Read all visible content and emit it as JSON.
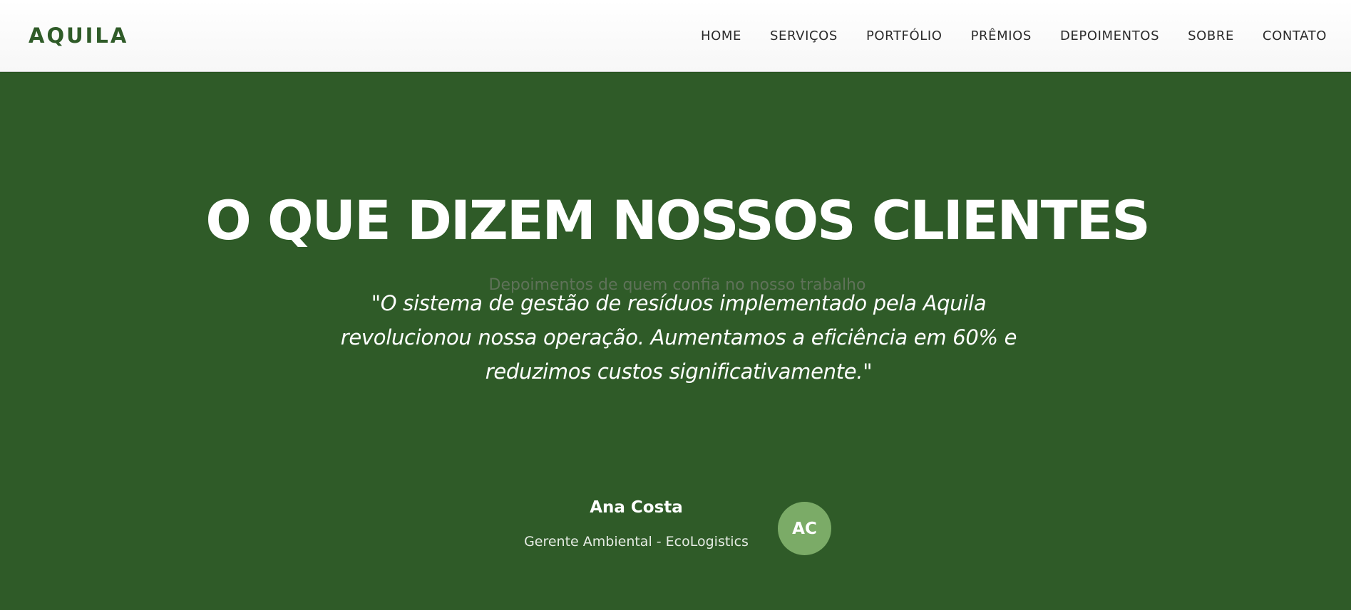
{
  "nav": {
    "logo": "AQUILA",
    "links": [
      "HOME",
      "SERVIÇOS",
      "PORTFÓLIO",
      "PRÊMIOS",
      "DEPOIMENTOS",
      "SOBRE",
      "CONTATO"
    ]
  },
  "hero": {
    "title": "O QUE DIZEM NOSSOS CLIENTES",
    "subtitle": "Depoimentos de quem confia no nosso trabalho"
  },
  "testimonial": {
    "quote": "\"O sistema de gestão de resíduos implementado pela Aquila revolucionou nossa operação. Aumentamos a eficiência em 60% e reduzimos custos significativamente.\"",
    "author_name": "Ana Costa",
    "author_role": "Gerente Ambiental - EcoLogistics",
    "avatar_initials": "AC"
  },
  "colors": {
    "brand_green": "#2f5b28",
    "avatar_green": "#7bab67",
    "nav_background": "#ffffff",
    "subtitle_gray": "#5f7259"
  }
}
